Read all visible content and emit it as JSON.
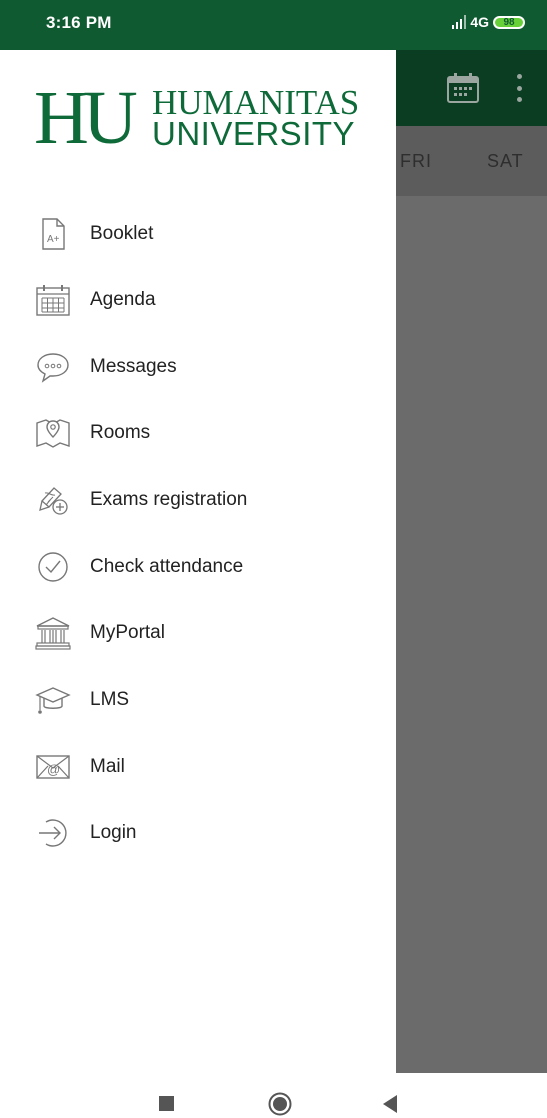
{
  "status_bar": {
    "time": "3:16 PM",
    "network": "4G",
    "battery": "98"
  },
  "background": {
    "days": [
      "FRI",
      "SAT"
    ]
  },
  "logo": {
    "mark": "HU",
    "line1": "HUMANITAS",
    "line2": "UNIVERSITY"
  },
  "menu": {
    "items": [
      {
        "label": "Booklet",
        "icon": "booklet-icon"
      },
      {
        "label": "Agenda",
        "icon": "calendar-icon"
      },
      {
        "label": "Messages",
        "icon": "chat-bubble-icon"
      },
      {
        "label": "Rooms",
        "icon": "map-pin-icon"
      },
      {
        "label": "Exams registration",
        "icon": "exam-pen-icon"
      },
      {
        "label": "Check attendance",
        "icon": "check-circle-icon"
      },
      {
        "label": "MyPortal",
        "icon": "building-icon"
      },
      {
        "label": "LMS",
        "icon": "graduation-cap-icon"
      },
      {
        "label": "Mail",
        "icon": "mail-icon"
      },
      {
        "label": "Login",
        "icon": "login-arrow-icon"
      }
    ]
  },
  "colors": {
    "brand_green": "#0f6a39",
    "status_bar": "#0f5a31",
    "scrim": "#6b6b6b"
  }
}
